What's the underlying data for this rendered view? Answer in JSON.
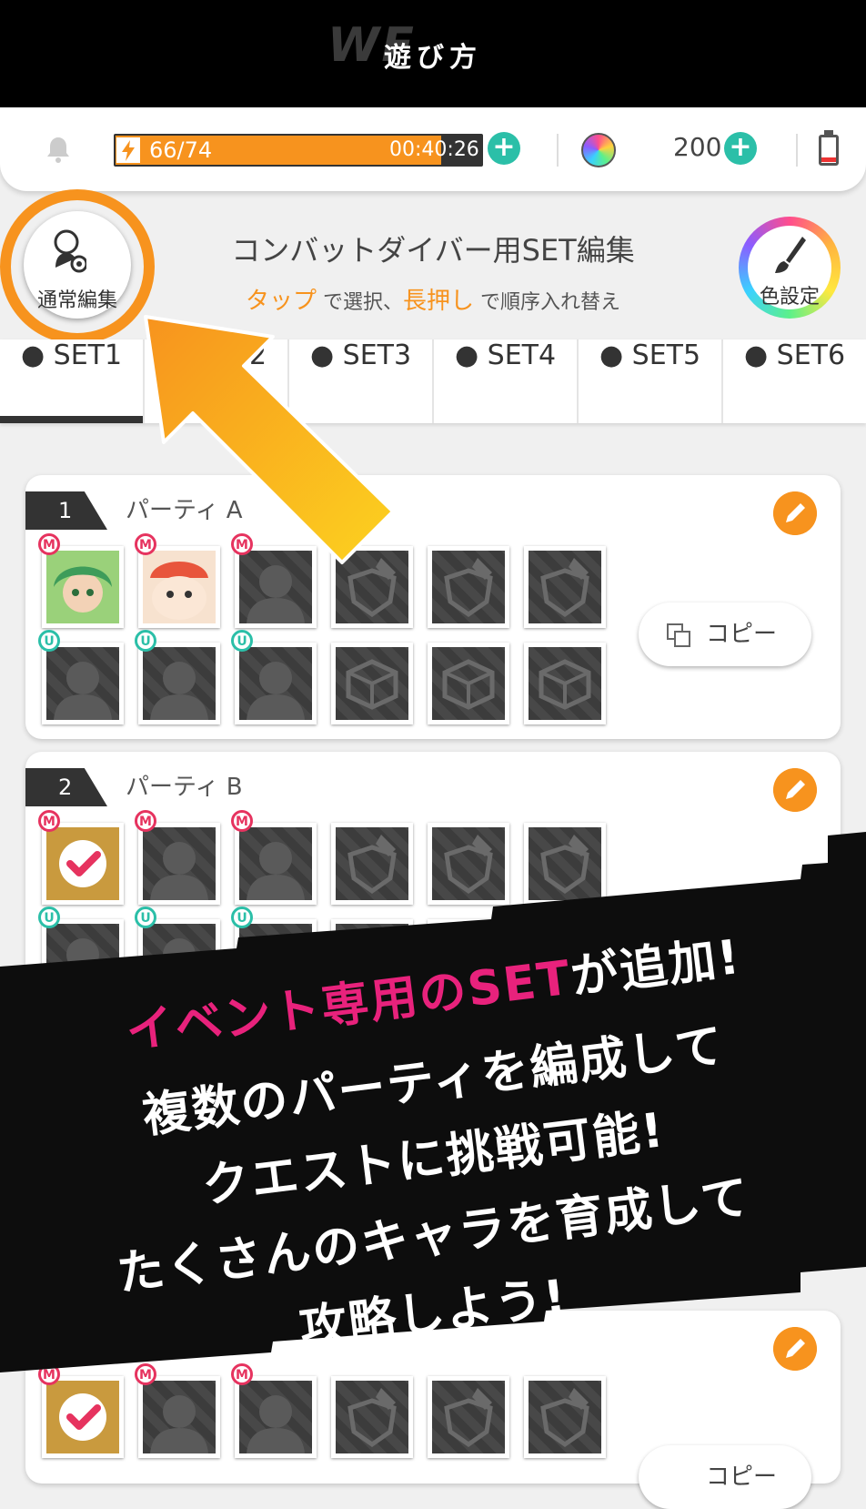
{
  "header": {
    "title": "遊び方"
  },
  "status": {
    "stamina_text": "66/74",
    "stamina_timer": "00:40:26",
    "stamina_fraction": 0.89,
    "gems": "200",
    "plus": "+"
  },
  "edit_header": {
    "normal_edit_label": "通常編集",
    "heading": "コンバットダイバー用SET編集",
    "instruction": {
      "tap": "タップ",
      "select": " で選択、",
      "hold": "長押し",
      "reorder": " で順序入れ替え"
    },
    "color_settings_label": "色設定"
  },
  "tabs": [
    "● SET1",
    "● SET2",
    "● SET3",
    "● SET4",
    "● SET5",
    "● SET6"
  ],
  "parties": [
    {
      "number": "1",
      "name": "パーティ A",
      "copy_label": "コピー"
    },
    {
      "number": "2",
      "name": "パーティ B",
      "copy_label": "コピー"
    }
  ],
  "badges": {
    "main": "M",
    "unison": "U"
  },
  "banner": {
    "line1_pink": "イベント専用のSET",
    "line1_white": "が追加!",
    "line2": "複数のパーティを編成して",
    "line3": "クエストに挑戦可能!",
    "line4": "たくさんのキャラを育成して",
    "line5": "攻略しよう!"
  },
  "colors": {
    "accent_orange": "#f7931e",
    "teal": "#2bbfa8",
    "pink": "#e8227c"
  }
}
